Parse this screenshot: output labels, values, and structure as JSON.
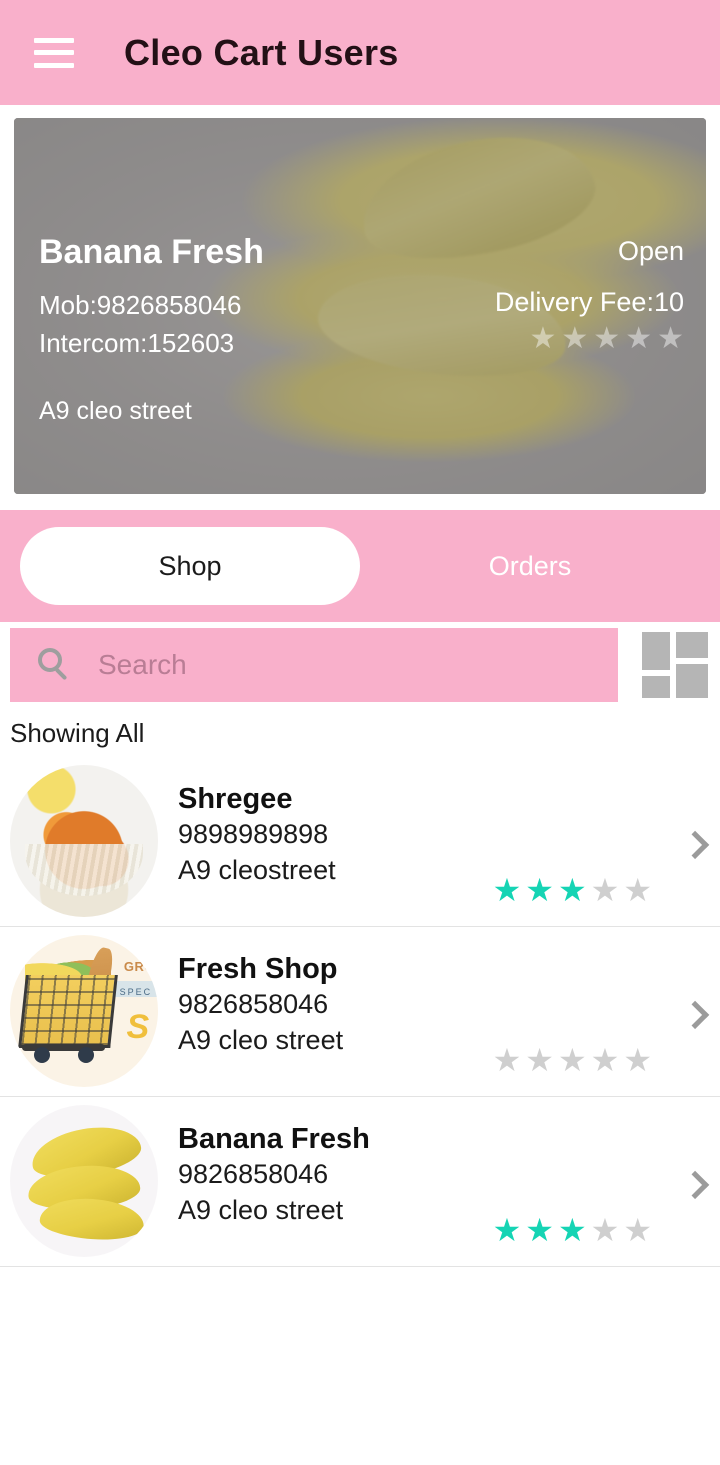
{
  "colors": {
    "brand_pink": "#f9b0cb",
    "star_active": "#15d4b4",
    "star_inactive": "#cfcfcf",
    "text_dark": "#1b1b1b"
  },
  "header": {
    "menu_icon": "hamburger-menu-icon",
    "title": "Cleo Cart Users"
  },
  "hero": {
    "image_alt": "bananas",
    "name": "Banana Fresh",
    "mobile": "Mob:9826858046",
    "intercom": "Intercom:152603",
    "address": "A9 cleo street",
    "status": "Open",
    "delivery_fee": "Delivery Fee:10",
    "rating": 0,
    "max_rating": 5
  },
  "tabs": [
    {
      "label": "Shop",
      "active": true
    },
    {
      "label": "Orders",
      "active": false
    }
  ],
  "search": {
    "icon": "search-icon",
    "value": "",
    "placeholder": "Search"
  },
  "view_toggle": {
    "icon": "grid-layout-icon"
  },
  "list_header": "Showing All",
  "shops": [
    {
      "name": "Shregee",
      "phone": "9898989898",
      "address": "A9 cleostreet",
      "rating": 3,
      "max_rating": 5,
      "thumb": "curry",
      "chevron": "chevron-right-icon"
    },
    {
      "name": "Fresh Shop",
      "phone": "9826858046",
      "address": "A9 cleo street",
      "rating": 0,
      "max_rating": 5,
      "thumb": "grocery",
      "thumb_text": {
        "line1": "GRO",
        "line2": "SPEC",
        "line3": "S"
      },
      "chevron": "chevron-right-icon"
    },
    {
      "name": "Banana Fresh",
      "phone": "9826858046",
      "address": "A9 cleo street",
      "rating": 3,
      "max_rating": 5,
      "thumb": "banana",
      "chevron": "chevron-right-icon"
    }
  ]
}
